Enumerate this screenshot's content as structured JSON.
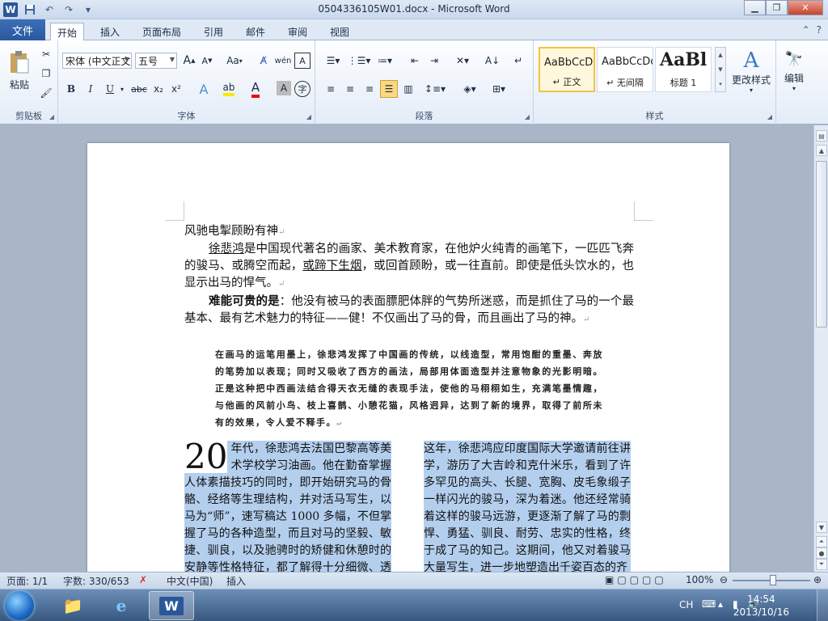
{
  "window": {
    "title": "0504336105W01.docx - Microsoft Word",
    "app_icon_letter": "W"
  },
  "tabs": {
    "file": "文件",
    "items": [
      "开始",
      "插入",
      "页面布局",
      "引用",
      "邮件",
      "审阅",
      "视图"
    ],
    "active": "开始"
  },
  "ribbon": {
    "clipboard": {
      "label": "剪贴板",
      "paste": "粘贴"
    },
    "font": {
      "label": "字体",
      "font_name": "宋体 (中文正文",
      "font_size": "五号",
      "grow": "A",
      "shrink": "A",
      "case": "Aa",
      "bold": "B",
      "italic": "I",
      "underline": "U",
      "strike": "abc",
      "sub": "x₂",
      "sup": "x²"
    },
    "paragraph": {
      "label": "段落"
    },
    "styles": {
      "label": "样式",
      "items": [
        {
          "sample": "AaBbCcDc",
          "name": "↵ 正文"
        },
        {
          "sample": "AaBbCcDc",
          "name": "↵ 无间隔"
        },
        {
          "sample": "AaBl",
          "name": "标题 1"
        }
      ],
      "change_styles": "更改样式"
    },
    "editing": {
      "label": "编辑"
    }
  },
  "document": {
    "heading": "风驰电掣顾盼有神",
    "para1_a": "徐悲鸿",
    "para1_b": "是中国现代著名的画家、美术教育家，在他炉火纯青的画笔下，一匹匹飞奔的骏马、或腾空而起，",
    "para1_c": "或蹄下生烟",
    "para1_d": "，或回首顾盼，或一往直前。即使是低头饮水的，也显示出马的悍气。",
    "para2_bold": "难能可贵的是",
    "para2_rest": "：他没有被马的表面膘肥体胖的气势所迷惑，而是抓住了马的一个最基本、最有艺术魅力的特征——健！不仅画出了马的骨，而且画出了马的神。",
    "quote": "在画马的运笔用墨上，徐悲鸿发挥了中国画的传统，以线造型，常用饱酣的重墨、奔放的笔势加以表现；同时又吸收了西方的画法，局部用体面造型并注意物象的光影明暗。正是这种把中西画法结合得天衣无缝的表现手法，使他的马栩栩如生，充满笔墨情趣，与他画的风前小鸟、枝上喜鹊、小憩花猫，风格迥异，达到了新的境界，取得了前所未有的效果，令人爱不释手。",
    "dropcap": "20",
    "col_left": "年代，徐悲鸿去法国巴黎高等美术学校学习油画。他在勤奋掌握人体素描技巧的同时，即开始研究马的骨骼、经络等生理结构，并对活马写生，以马为“师”，速写稿达 1000 多幅，不但掌握了马的各种造型，而且对马的坚毅、敏捷、驯良，以及驰骋时的矫健和休憩时的安静等性格特征，都了解得十分细微、透彻。",
    "col_right": "这年，徐悲鸿应印度国际大学邀请前往讲学，游历了大吉岭和克什米乐，看到了许多罕见的高头、长腿、宽胸、皮毛象缎子一样闪光的骏马，深为着迷。他还经常骑着这样的骏马远游，更逐渐了解了马的剽悍、勇猛、驯良、耐劳、忠实的性格，终于成了马的知己。这期间，他又对着骏马大量写生，进一步地塑造出千姿百态的齐"
  },
  "statusbar": {
    "page": "页面: 1/1",
    "words": "字数: 330/653",
    "language": "中文(中国)",
    "mode": "插入",
    "zoom": "100%"
  },
  "taskbar": {
    "ime": "CH",
    "time": "14:54",
    "date": "2013/10/16"
  },
  "colors": {
    "file_tab": "#2a58a0",
    "selection": "#b4cfee",
    "style_selected": "#f3c344"
  }
}
